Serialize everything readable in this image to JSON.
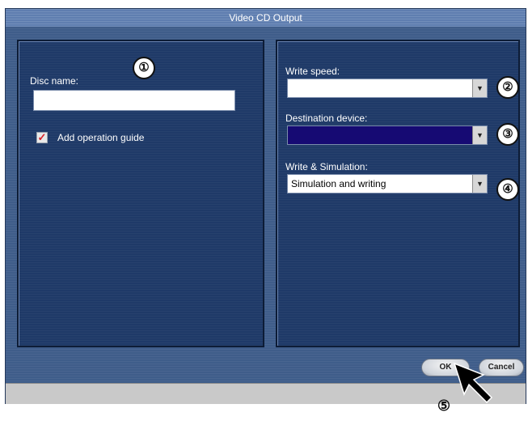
{
  "window": {
    "title": "Video CD Output"
  },
  "left_panel": {
    "disc_name_label": "Disc name:",
    "disc_name_value": "",
    "add_guide_label": "Add operation guide",
    "add_guide_checked": true
  },
  "right_panel": {
    "write_speed_label": "Write speed:",
    "write_speed_value": "",
    "destination_label": "Destination device:",
    "destination_value": "",
    "write_sim_label": "Write & Simulation:",
    "write_sim_value": "Simulation and writing"
  },
  "buttons": {
    "ok_label": "OK",
    "cancel_label": "Cancel"
  },
  "callouts": [
    "①",
    "②",
    "③",
    "④",
    "⑤"
  ],
  "icons": {
    "checkbox_mark": "check-icon",
    "dropdown": "chevron-down-icon",
    "pointer": "cursor-arrow-icon"
  },
  "colors": {
    "window_bg": "#3f5d8a",
    "panel_bg": "#1f3a68",
    "destination_select_bg": "#160a73",
    "checkbox_mark": "#d8232a"
  }
}
